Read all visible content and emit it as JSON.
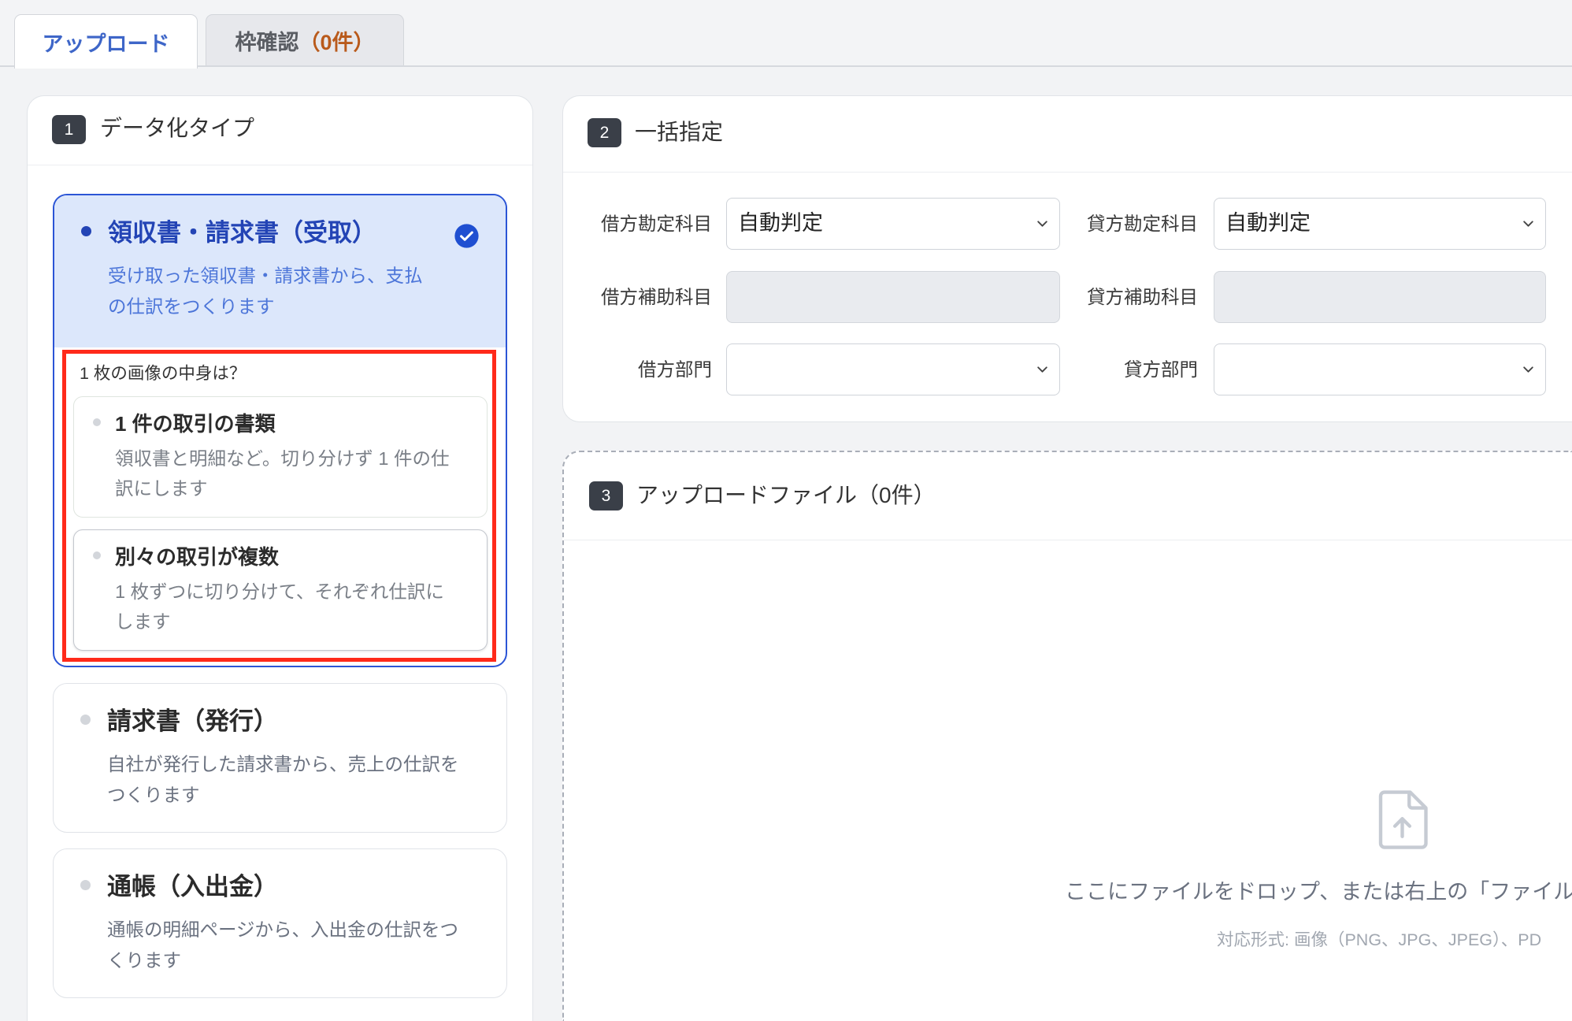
{
  "colors": {
    "accent": "#2b55d6",
    "selected_background": "#dce7fb",
    "highlight_box": "#ff2a1a",
    "count_text": "#b95a1b",
    "step_badge": "#3a3f48"
  },
  "tabs": {
    "upload": {
      "label": "アップロード",
      "active": true
    },
    "frame_check": {
      "label": "枠確認",
      "count": "（0件）",
      "active": false
    }
  },
  "data_type": {
    "step": "1",
    "title": "データ化タイプ",
    "options": [
      {
        "title": "領収書・請求書（受取）",
        "description": "受け取った領収書・請求書から、支払の仕訳をつくります",
        "selected": true,
        "selected_icon": "check-circle-icon",
        "sub_question": "1 枚の画像の中身は？",
        "sub_options": [
          {
            "title": "1 件の取引の書類",
            "description": "領収書と明細など。切り分けず 1 件の仕訳にします"
          },
          {
            "title": "別々の取引が複数",
            "description": "1 枚ずつに切り分けて、それぞれ仕訳にします"
          }
        ]
      },
      {
        "title": "請求書（発行）",
        "description": "自社が発行した請求書から、売上の仕訳をつくります",
        "selected": false
      },
      {
        "title": "通帳（入出金）",
        "description": "通帳の明細ページから、入出金の仕訳をつくります",
        "selected": false
      }
    ]
  },
  "bulk_settings": {
    "step": "2",
    "title": "一括指定",
    "dropdown_icon": "chevron-down-icon",
    "fields": [
      {
        "label": "借方勘定科目",
        "value": "自動判定"
      },
      {
        "label": "貸方勘定科目",
        "value": "自動判定"
      },
      {
        "label": "借方補助科目",
        "disabled": true
      },
      {
        "label": "貸方補助科目",
        "disabled": true
      },
      {
        "label": "借方部門"
      },
      {
        "label": "貸方部門"
      }
    ]
  },
  "upload_files": {
    "step": "3",
    "title": "アップロードファイル（0件）",
    "dropzone": {
      "icon": "file-upload-icon",
      "message": "ここにファイルをドロップ、または右上の「ファイル",
      "formats": "対応形式: 画像（PNG、JPG、JPEG）、PD"
    }
  }
}
